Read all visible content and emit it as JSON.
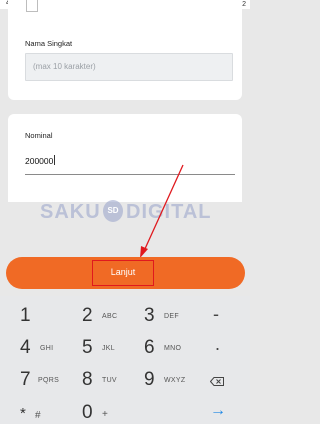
{
  "status_bar": {
    "left_text": "4",
    "right_text": "2"
  },
  "form": {
    "nama_singkat_label": "Nama Singkat",
    "nama_singkat_placeholder": "(max 10 karakter)",
    "nominal_label": "Nominal",
    "nominal_value": "200000"
  },
  "watermark": {
    "left": "SAKU",
    "badge": "SD",
    "right": "DIGITAL"
  },
  "action": {
    "lanjut_label": "Lanjut"
  },
  "colors": {
    "accent_orange": "#f06a25",
    "highlight_red": "#e0191e",
    "go_blue": "#1e88e5"
  },
  "keypad": {
    "rows": [
      [
        {
          "digit": "1",
          "letters": ""
        },
        {
          "digit": "2",
          "letters": "ABC"
        },
        {
          "digit": "3",
          "letters": "DEF"
        },
        {
          "symbol": "-"
        }
      ],
      [
        {
          "digit": "4",
          "letters": "GHI"
        },
        {
          "digit": "5",
          "letters": "JKL"
        },
        {
          "digit": "6",
          "letters": "MNO"
        },
        {
          "symbol": "."
        }
      ],
      [
        {
          "digit": "7",
          "letters": "PQRS"
        },
        {
          "digit": "8",
          "letters": "TUV"
        },
        {
          "digit": "9",
          "letters": "WXYZ"
        },
        {
          "icon": "backspace-icon"
        }
      ],
      [
        {
          "digit": "*",
          "letters": "#"
        },
        {
          "digit": "0",
          "letters": "+"
        },
        {
          "symbol": ""
        },
        {
          "icon": "go-arrow-icon",
          "symbol": "→"
        }
      ]
    ]
  }
}
